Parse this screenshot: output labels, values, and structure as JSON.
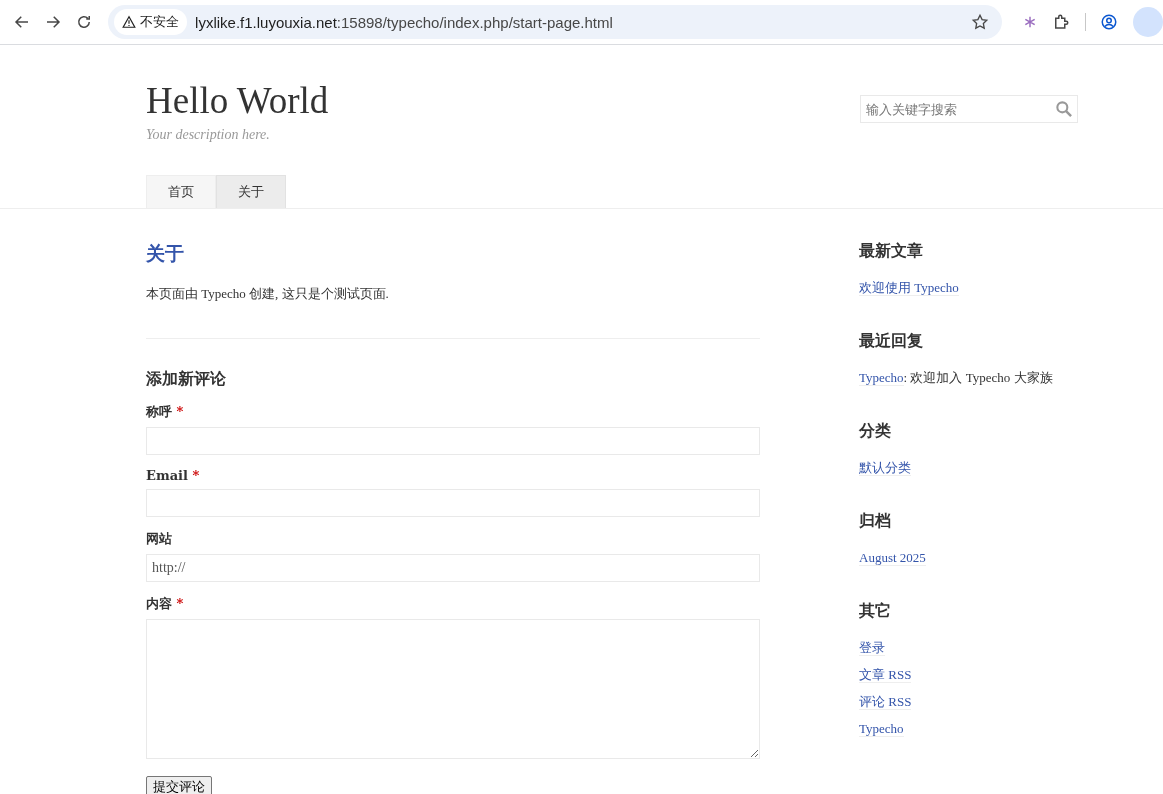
{
  "browser": {
    "security_label": "不安全",
    "url_host": "lyxlike.f1.luyouxia.net",
    "url_path": ":15898/typecho/index.php/start-page.html"
  },
  "header": {
    "title": "Hello World",
    "description": "Your description here.",
    "search": {
      "placeholder": "输入关键字搜索"
    }
  },
  "nav": [
    {
      "label": "首页",
      "selected": false
    },
    {
      "label": "关于",
      "selected": true
    }
  ],
  "page": {
    "title": "关于",
    "body": "本页面由 Typecho 创建, 这只是个测试页面."
  },
  "comment_form": {
    "title": "添加新评论",
    "fields": [
      {
        "kind": "input",
        "label": "称呼",
        "required_mark": "*"
      },
      {
        "kind": "input",
        "label": "Email",
        "required_mark": "*"
      },
      {
        "kind": "input",
        "label": "网站",
        "placeholder": "http://"
      },
      {
        "kind": "textarea",
        "label": "内容",
        "required_mark": "*"
      }
    ],
    "submit": "提交评论"
  },
  "sidebar": [
    {
      "title": "最新文章",
      "items": [
        {
          "link": "欢迎使用 Typecho"
        }
      ]
    },
    {
      "title": "最近回复",
      "items": [
        {
          "link": "Typecho",
          "text": ": 欢迎加入 Typecho 大家族"
        }
      ]
    },
    {
      "title": "分类",
      "items": [
        {
          "link": "默认分类"
        }
      ]
    },
    {
      "title": "归档",
      "items": [
        {
          "link": "August 2025"
        }
      ]
    },
    {
      "title": "其它",
      "items": [
        {
          "link": "登录"
        },
        {
          "link": "文章 RSS"
        },
        {
          "link": "评论 RSS"
        },
        {
          "link": "Typecho"
        }
      ]
    }
  ]
}
